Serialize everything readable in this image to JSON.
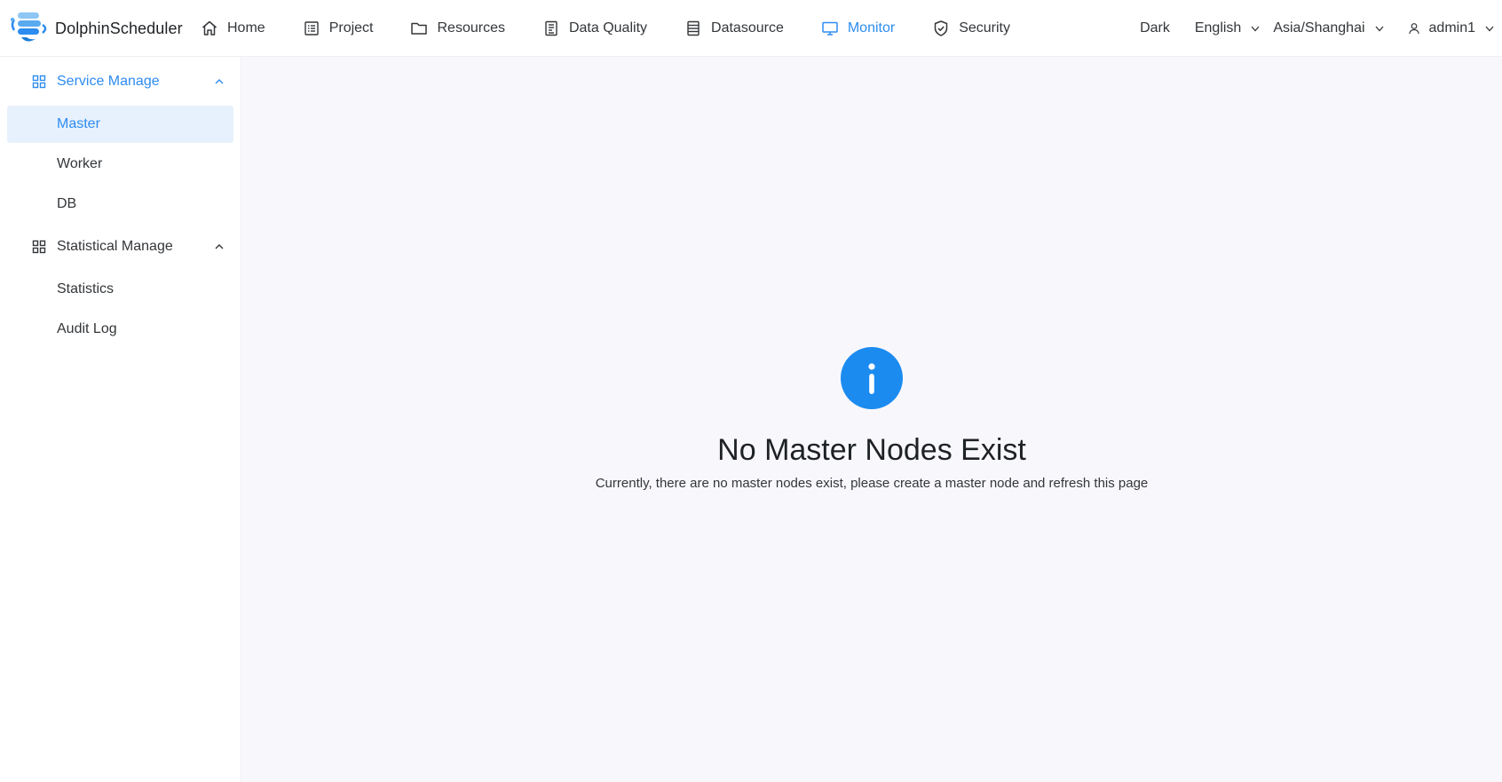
{
  "app": {
    "name": "DolphinScheduler",
    "accent_color": "#2d8cf0"
  },
  "nav": [
    {
      "label": "Home",
      "icon": "home-icon",
      "active": false
    },
    {
      "label": "Project",
      "icon": "project-icon",
      "active": false
    },
    {
      "label": "Resources",
      "icon": "folder-icon",
      "active": false
    },
    {
      "label": "Data Quality",
      "icon": "document-icon",
      "active": false
    },
    {
      "label": "Datasource",
      "icon": "database-icon",
      "active": false
    },
    {
      "label": "Monitor",
      "icon": "monitor-icon",
      "active": true
    },
    {
      "label": "Security",
      "icon": "shield-icon",
      "active": false
    }
  ],
  "header_right": {
    "theme": "Dark",
    "language": "English",
    "timezone": "Asia/Shanghai",
    "user": "admin1"
  },
  "sidebar": {
    "groups": [
      {
        "label": "Service Manage",
        "icon": "grid-icon",
        "expanded": true,
        "active": true,
        "items": [
          {
            "label": "Master",
            "selected": true
          },
          {
            "label": "Worker",
            "selected": false
          },
          {
            "label": "DB",
            "selected": false
          }
        ]
      },
      {
        "label": "Statistical Manage",
        "icon": "grid-icon",
        "expanded": true,
        "active": false,
        "items": [
          {
            "label": "Statistics",
            "selected": false
          },
          {
            "label": "Audit Log",
            "selected": false
          }
        ]
      }
    ]
  },
  "empty_state": {
    "icon": "info-icon",
    "title": "No Master Nodes Exist",
    "description": "Currently, there are no master nodes exist, please create a master node and refresh this page"
  }
}
